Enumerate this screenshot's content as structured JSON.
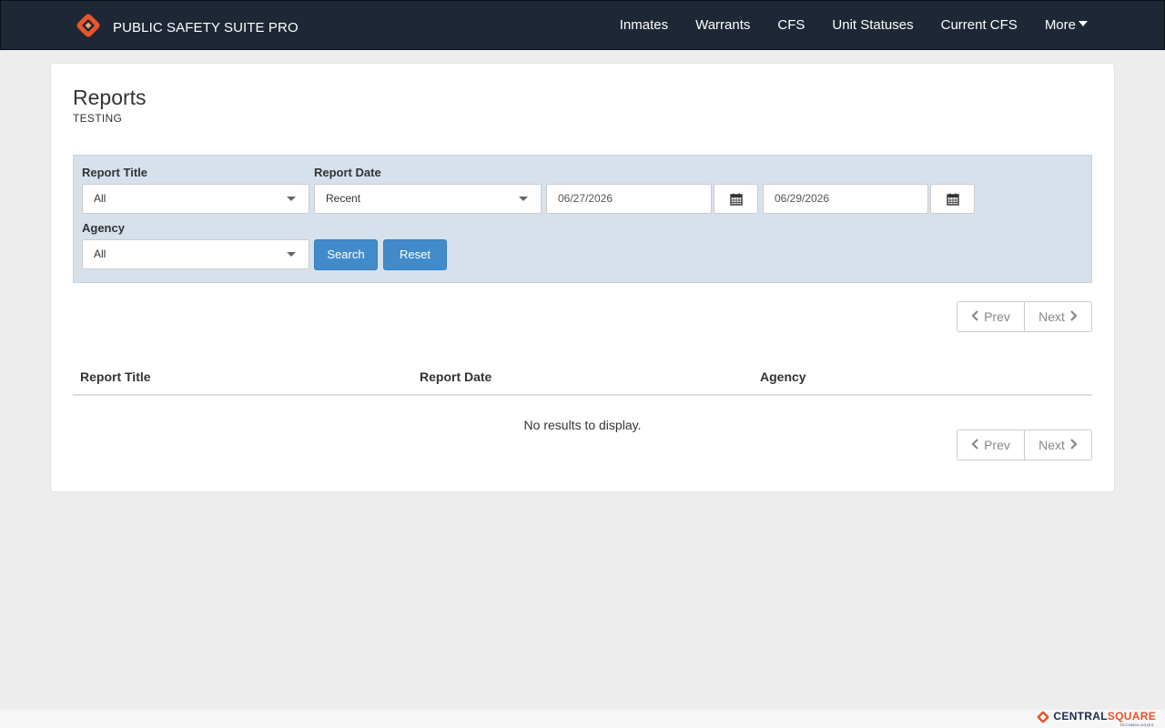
{
  "app": {
    "brand": "PUBLIC SAFETY SUITE PRO",
    "nav": [
      "Inmates",
      "Warrants",
      "CFS",
      "Unit Statuses",
      "Current CFS"
    ],
    "more_label": "More"
  },
  "page": {
    "title": "Reports",
    "subtitle": "TESTING"
  },
  "filters": {
    "report_title_label": "Report Title",
    "report_title_value": "All",
    "report_date_label": "Report Date",
    "report_date_value": "Recent",
    "date_from": "06/27/2026",
    "date_to": "06/29/2026",
    "agency_label": "Agency",
    "agency_value": "All",
    "search_label": "Search",
    "reset_label": "Reset"
  },
  "pager": {
    "prev_label": "Prev",
    "next_label": "Next"
  },
  "table": {
    "columns": [
      "Report Title",
      "Report Date",
      "Agency"
    ],
    "empty_message": "No results to display."
  },
  "footer": {
    "logo_part1": "CENTRAL",
    "logo_part2": "SQUARE",
    "logo_sub": "TECHNOLOGIES"
  },
  "colors": {
    "navbar": "#1e2735",
    "accent": "#e8552a",
    "filter_bg": "#d6e1ec",
    "button": "#428bca"
  },
  "icons": [
    "brand-logo-icon",
    "calendar-icon",
    "chevron-left-icon",
    "chevron-right-icon",
    "caret-down-icon"
  ]
}
